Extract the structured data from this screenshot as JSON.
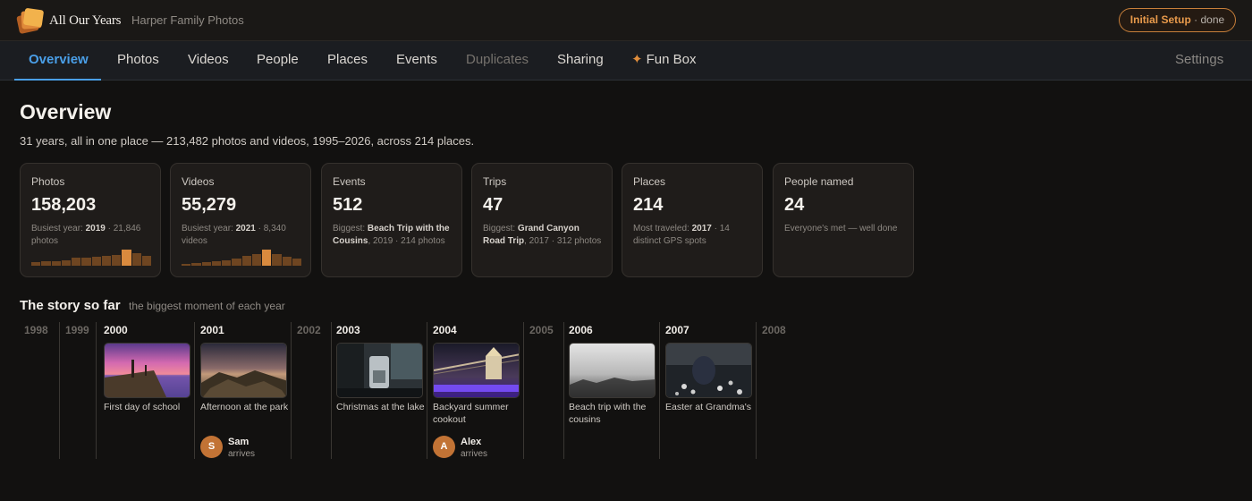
{
  "header": {
    "app_name": "All Our Years",
    "library_name": "Harper Family Photos",
    "setup": {
      "label": "Initial Setup",
      "separator": " · ",
      "status": "done"
    }
  },
  "nav": {
    "items": [
      {
        "label": "Overview",
        "state": "active"
      },
      {
        "label": "Photos",
        "state": "normal"
      },
      {
        "label": "Videos",
        "state": "normal"
      },
      {
        "label": "People",
        "state": "normal"
      },
      {
        "label": "Places",
        "state": "normal"
      },
      {
        "label": "Events",
        "state": "normal"
      },
      {
        "label": "Duplicates",
        "state": "disabled"
      },
      {
        "label": "Sharing",
        "state": "normal"
      },
      {
        "label": "Fun Box",
        "state": "normal",
        "icon": "sparkle-icon",
        "icon_glyph": "✦"
      }
    ],
    "settings_label": "Settings"
  },
  "page": {
    "title": "Overview",
    "subtitle": "31 years, all in one place — 213,482 photos and videos, 1995–2026, across 214 places."
  },
  "stats": [
    {
      "label": "Photos",
      "value": "158,203",
      "note_pre": "Busiest year: ",
      "note_bold": "2019",
      "note_post": " · 21,846 photos",
      "trend": [
        0.22,
        0.3,
        0.26,
        0.36,
        0.5,
        0.48,
        0.55,
        0.6,
        0.66,
        1.0,
        0.78,
        0.6
      ]
    },
    {
      "label": "Videos",
      "value": "55,279",
      "note_pre": "Busiest year: ",
      "note_bold": "2021",
      "note_post": " · 8,340 videos",
      "trend": [
        0.1,
        0.14,
        0.22,
        0.28,
        0.35,
        0.45,
        0.6,
        0.72,
        1.0,
        0.7,
        0.55,
        0.42
      ]
    },
    {
      "label": "Events",
      "value": "512",
      "note_pre": "Biggest: ",
      "note_bold": "Beach Trip with the Cousins",
      "note_post": ", 2019 · 214 photos"
    },
    {
      "label": "Trips",
      "value": "47",
      "note_pre": "Biggest: ",
      "note_bold": "Grand Canyon Road Trip",
      "note_post": ", 2017 · 312 photos"
    },
    {
      "label": "Places",
      "value": "214",
      "note_pre": "Most traveled: ",
      "note_bold": "2017",
      "note_post": " · 14 distinct GPS spots"
    },
    {
      "label": "People named",
      "value": "24",
      "note_pre": "Everyone's met — well done",
      "note_bold": "",
      "note_post": ""
    }
  ],
  "story": {
    "title": "The story so far",
    "subtitle": "the biggest moment of each year",
    "years": [
      {
        "year": "1998"
      },
      {
        "year": "1999"
      },
      {
        "year": "2000",
        "caption": "First day of school",
        "photo": "sunset-pier"
      },
      {
        "year": "2001",
        "caption": "Afternoon at the park",
        "photo": "rocky-coast",
        "person": {
          "initial": "S",
          "name": "Sam",
          "note": "arrives"
        }
      },
      {
        "year": "2002"
      },
      {
        "year": "2003",
        "caption": "Christmas at the lake",
        "photo": "coffee-shop"
      },
      {
        "year": "2004",
        "caption": "Backyard summer cookout",
        "photo": "city-bridge",
        "person": {
          "initial": "A",
          "name": "Alex",
          "note": "arrives"
        }
      },
      {
        "year": "2005"
      },
      {
        "year": "2006",
        "caption": "Beach trip with the cousins",
        "photo": "foggy-field"
      },
      {
        "year": "2007",
        "caption": "Easter at Grandma's",
        "photo": "flower-field"
      },
      {
        "year": "2008"
      }
    ]
  },
  "colors": {
    "accent_blue": "#4a9fe8",
    "accent_orange": "#d98a3e",
    "background": "#121110"
  }
}
